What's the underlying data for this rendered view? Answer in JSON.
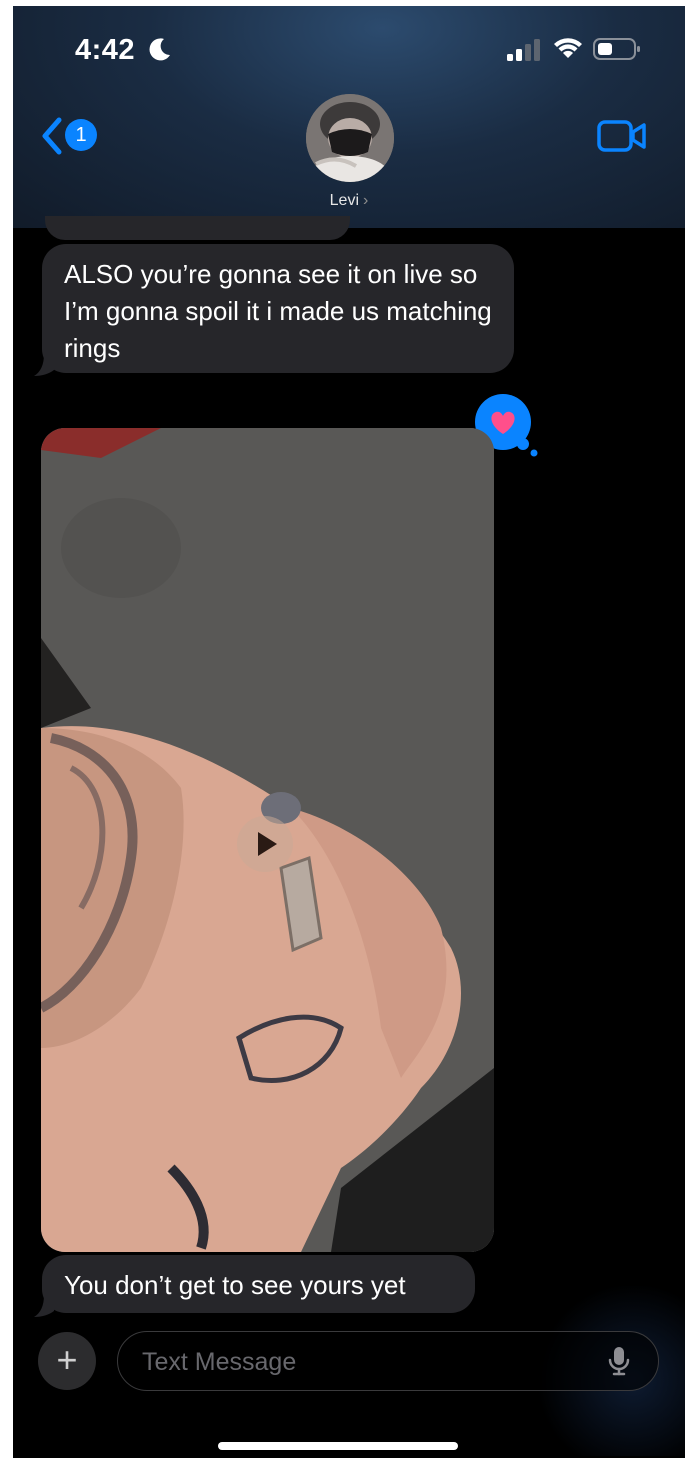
{
  "status_bar": {
    "time": "4:42",
    "icons": [
      "moon-icon",
      "cellular-signal-icon",
      "wifi-icon",
      "battery-icon"
    ]
  },
  "nav": {
    "back_badge_count": "1",
    "contact_name": "Levi",
    "contact_chevron": "›",
    "video_icon": "video-camera-icon"
  },
  "messages": [
    {
      "direction": "incoming",
      "type": "text",
      "text": "ALSO you’re gonna see it on live so I’m gonna spoil it i made us matching rings"
    },
    {
      "direction": "incoming",
      "type": "video",
      "tapback": "heart",
      "tapback_color": "#0a84ff",
      "heart_color": "#ff4f8b"
    },
    {
      "direction": "incoming",
      "type": "text",
      "text": "You don’t get to see yours yet"
    }
  ],
  "composer": {
    "plus_label": "+",
    "placeholder": "Text Message"
  },
  "colors": {
    "accent": "#0a84ff",
    "bubble_incoming": "#26262a",
    "background": "#000000"
  }
}
